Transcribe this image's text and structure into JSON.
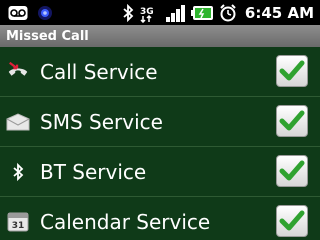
{
  "status_bar": {
    "time": "6:45 AM",
    "network_badge": "3G",
    "icons": [
      "voicemail-icon",
      "blue-dot-icon",
      "bluetooth-icon",
      "3g-icon",
      "signal-icon",
      "battery-icon",
      "alarm-icon"
    ],
    "battery_color": "#2fb52f"
  },
  "screen": {
    "title": "Missed Call"
  },
  "list": {
    "items": [
      {
        "label": "Call Service",
        "icon": "phone-icon",
        "checked": true
      },
      {
        "label": "SMS Service",
        "icon": "envelope-icon",
        "checked": true
      },
      {
        "label": "BT Service",
        "icon": "bluetooth-icon",
        "checked": true
      },
      {
        "label": "Calendar Service",
        "icon": "calendar-icon",
        "checked": true
      }
    ]
  },
  "calendar_icon_day": "31",
  "colors": {
    "background": "#113a19",
    "title_bar": "#7a7a7a",
    "check": "#2fa22f"
  }
}
